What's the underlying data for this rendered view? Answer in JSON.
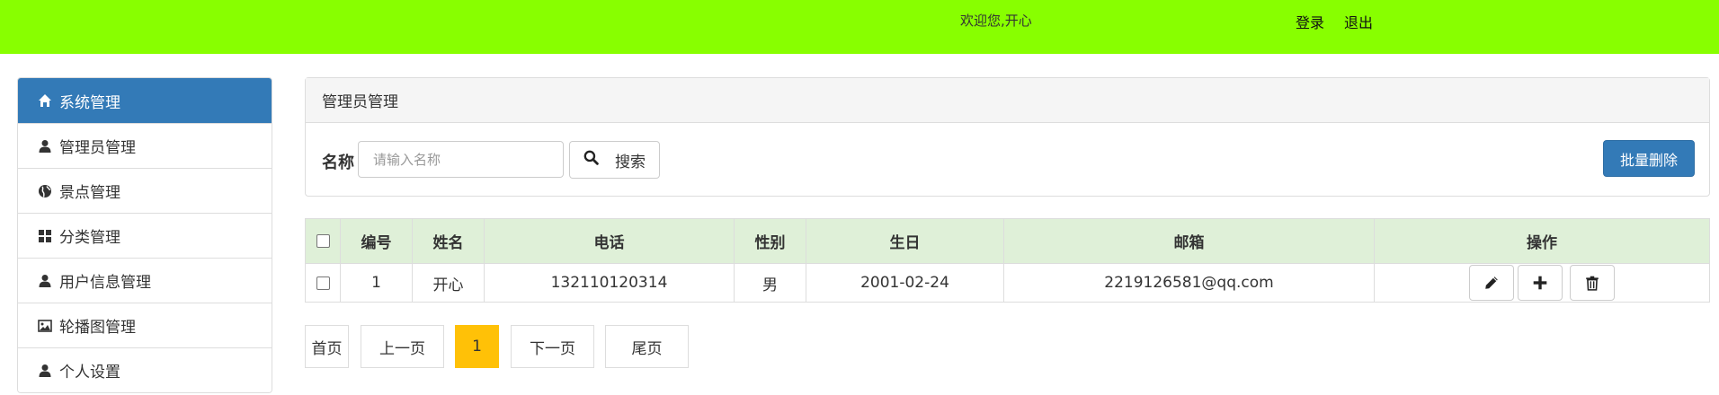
{
  "header": {
    "welcome": "欢迎您,开心",
    "login": "登录",
    "logout": "退出"
  },
  "sidebar": {
    "items": [
      {
        "label": "系统管理",
        "icon": "home-icon",
        "active": true
      },
      {
        "label": "管理员管理",
        "icon": "user-icon"
      },
      {
        "label": "景点管理",
        "icon": "globe-icon"
      },
      {
        "label": "分类管理",
        "icon": "grid-icon"
      },
      {
        "label": "用户信息管理",
        "icon": "user-icon"
      },
      {
        "label": "轮播图管理",
        "icon": "picture-icon"
      },
      {
        "label": "个人设置",
        "icon": "user-icon"
      }
    ]
  },
  "panel": {
    "title": "管理员管理",
    "name_label": "名称",
    "search_placeholder": "请输入名称",
    "search_label": "搜索",
    "batch_delete": "批量删除"
  },
  "table": {
    "headers": [
      "编号",
      "姓名",
      "电话",
      "性别",
      "生日",
      "邮箱",
      "操作"
    ],
    "rows": [
      {
        "id": "1",
        "name": "开心",
        "phone": "132110120314",
        "gender": "男",
        "birthday": "2001-02-24",
        "email": "2219126581@qq.com"
      }
    ]
  },
  "pagination": {
    "first": "首页",
    "prev": "上一页",
    "current": "1",
    "next": "下一页",
    "last": "尾页"
  },
  "colors": {
    "topbar": "#88ff00",
    "primary": "#337ab7",
    "table_header": "#dff0d8",
    "current_page": "#ffc107"
  }
}
